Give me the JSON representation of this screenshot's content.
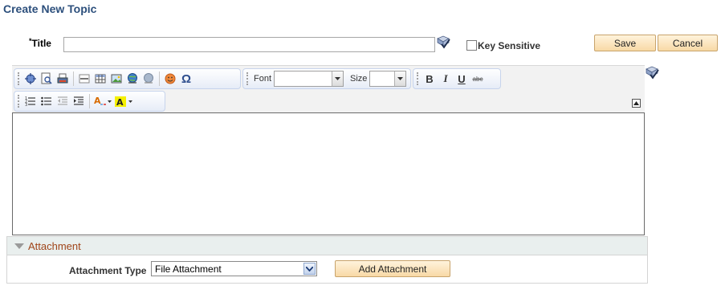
{
  "page": {
    "title": "Create New Topic"
  },
  "form": {
    "title_required_marker": "*",
    "title_label": "Title",
    "title_value": "",
    "key_sensitive_label": "Key Sensitive",
    "key_sensitive_checked": false
  },
  "buttons": {
    "save_label": "Save",
    "cancel_label": "Cancel",
    "add_attachment_label": "Add Attachment"
  },
  "toolbar": {
    "font_label": "Font",
    "size_label": "Size",
    "font_value": "",
    "size_value": "",
    "bold": "B",
    "italic": "I",
    "underline": "U",
    "strike": "abc",
    "special_char": "Ω",
    "icons": [
      "maximize-icon",
      "preview-icon",
      "print-icon",
      "horizontal-rule-icon",
      "table-icon",
      "image-icon",
      "link-icon",
      "unlink-icon",
      "smiley-icon",
      "special-char-icon",
      "bold-icon",
      "italic-icon",
      "underline-icon",
      "strikethrough-icon",
      "ordered-list-icon",
      "bullet-list-icon",
      "outdent-icon",
      "indent-icon",
      "text-color-icon",
      "bg-color-icon"
    ]
  },
  "editor": {
    "content": ""
  },
  "attachment": {
    "section_label": "Attachment",
    "type_label": "Attachment Type",
    "type_value": "File Attachment"
  },
  "colors": {
    "title": "#2c4f7c",
    "section_label": "#a0451a",
    "button_bg": "#f8d9a6",
    "toolbar_border": "#c7d4ec"
  }
}
